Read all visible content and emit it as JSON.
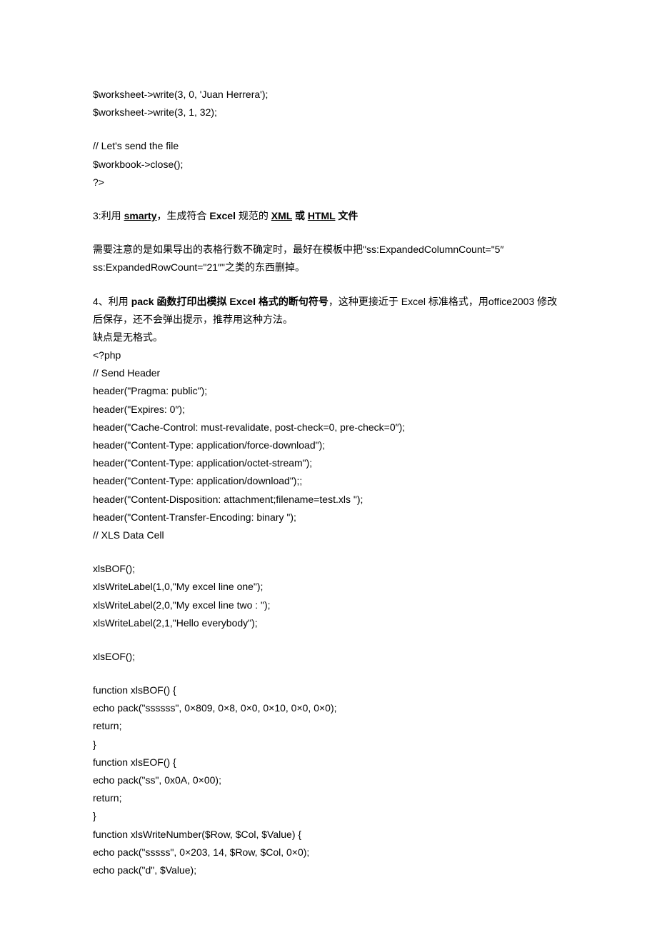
{
  "block1": {
    "line1": "$worksheet->write(3, 0, 'Juan Herrera');",
    "line2": "$worksheet->write(3, 1, 32);"
  },
  "block2": {
    "line1": "// Let's send the file",
    "line2": "$workbook->close();",
    "line3": "?>"
  },
  "section3": {
    "prefix": "3:利用 ",
    "link1": "smarty",
    "mid1": "，生成符合 ",
    "bold1": "Excel ",
    "mid2": "规范的 ",
    "link2": "XML",
    "mid3": " 或 ",
    "link3": "HTML",
    "suffix": " 文件"
  },
  "para1": "需要注意的是如果导出的表格行数不确定时，最好在模板中把\"ss:ExpandedColumnCount=\"5″ ss:ExpandedRowCount=\"21″\"之类的东西删掉。",
  "section4": {
    "prefix": "4、利用 ",
    "bold1": "pack ",
    "mid1": "函数打印出模拟 ",
    "bold2": "Excel ",
    "mid2": "格式的断句符号",
    "rest1": "，这种更接近于 Excel 标准格式，用office2003 修改后保存，还不会弹出提示，推荐用这种方法。",
    "line2": "缺点是无格式。",
    "line3": "<?php",
    "line4": "// Send Header",
    "line5": "header(\"Pragma: public\");",
    "line6": "header(\"Expires: 0″);",
    "line7": "header(\"Cache-Control: must-revalidate, post-check=0, pre-check=0″);",
    "line8": "header(\"Content-Type: application/force-download\");",
    "line9": "header(\"Content-Type: application/octet-stream\");",
    "line10": "header(\"Content-Type: application/download\");;",
    "line11": "header(\"Content-Disposition: attachment;filename=test.xls \");",
    "line12": "header(\"Content-Transfer-Encoding: binary \");",
    "line13": "// XLS Data Cell"
  },
  "block5": {
    "line1": "xlsBOF();",
    "line2": "xlsWriteLabel(1,0,\"My excel line one\");",
    "line3": "xlsWriteLabel(2,0,\"My excel line two : \");",
    "line4": "xlsWriteLabel(2,1,\"Hello everybody\");"
  },
  "block6": {
    "line1": "xlsEOF();"
  },
  "block7": {
    "line1": "function xlsBOF() {",
    "line2": "echo pack(\"ssssss\", 0×809, 0×8, 0×0, 0×10, 0×0, 0×0);",
    "line3": "return;",
    "line4": "}",
    "line5": "function xlsEOF() {",
    "line6": "echo pack(\"ss\", 0x0A, 0×00);",
    "line7": "return;",
    "line8": "}",
    "line9": "function xlsWriteNumber($Row, $Col, $Value) {",
    "line10": "echo pack(\"sssss\", 0×203, 14, $Row, $Col, 0×0);",
    "line11": "echo pack(\"d\", $Value);"
  }
}
